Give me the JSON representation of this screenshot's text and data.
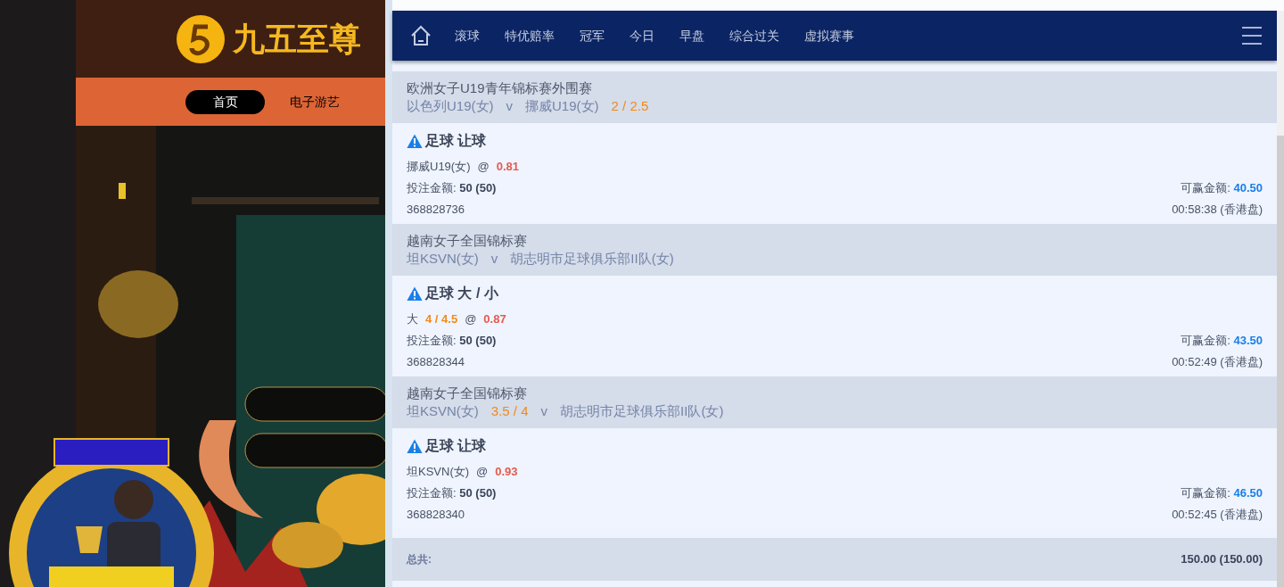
{
  "site": {
    "logo": "九五至尊",
    "nav": [
      {
        "label": "首页",
        "selected": true
      },
      {
        "label": "电子游艺",
        "selected": false
      }
    ]
  },
  "sportsbook": {
    "nav": [
      {
        "label": "滚球"
      },
      {
        "label": "特优赔率"
      },
      {
        "label": "冠军"
      },
      {
        "label": "今日"
      },
      {
        "label": "早盘"
      },
      {
        "label": "综合过关"
      },
      {
        "label": "虚拟赛事"
      }
    ],
    "bets": [
      {
        "league": "欧洲女子U19青年锦标赛外围赛",
        "teams": [
          {
            "kind": "team",
            "text": "以色列U19(女)"
          },
          {
            "kind": "vs",
            "text": "v"
          },
          {
            "kind": "team",
            "text": "挪威U19(女)"
          },
          {
            "kind": "handicap",
            "text": "2 / 2.5"
          }
        ],
        "market": "足球 让球",
        "selection": [
          {
            "kind": "pick",
            "text": "挪威U19(女)"
          },
          {
            "kind": "at",
            "text": "@"
          },
          {
            "kind": "odds",
            "text": "0.81"
          }
        ],
        "stake_label": "投注金额:",
        "stake": "50 (50)",
        "win_label": "可赢金额:",
        "win": "40.50",
        "ticket": "368828736",
        "time": "00:58:38 (香港盘)"
      },
      {
        "league": "越南女子全国锦标赛",
        "teams": [
          {
            "kind": "team",
            "text": "坦KSVN(女)"
          },
          {
            "kind": "vs",
            "text": "v"
          },
          {
            "kind": "team",
            "text": "胡志明市足球俱乐部II队(女)"
          }
        ],
        "market": "足球 大 / 小",
        "selection": [
          {
            "kind": "pick",
            "text": "大"
          },
          {
            "kind": "handicap",
            "text": "4 / 4.5"
          },
          {
            "kind": "at",
            "text": "@"
          },
          {
            "kind": "odds",
            "text": "0.87"
          }
        ],
        "stake_label": "投注金额:",
        "stake": "50 (50)",
        "win_label": "可赢金额:",
        "win": "43.50",
        "ticket": "368828344",
        "time": "00:52:49 (香港盘)"
      },
      {
        "league": "越南女子全国锦标赛",
        "teams": [
          {
            "kind": "team",
            "text": "坦KSVN(女)"
          },
          {
            "kind": "handicap",
            "text": "3.5 / 4"
          },
          {
            "kind": "vs",
            "text": "v"
          },
          {
            "kind": "team",
            "text": "胡志明市足球俱乐部II队(女)"
          }
        ],
        "market": "足球 让球",
        "selection": [
          {
            "kind": "pick",
            "text": "坦KSVN(女)"
          },
          {
            "kind": "at",
            "text": "@"
          },
          {
            "kind": "odds",
            "text": "0.93"
          }
        ],
        "stake_label": "投注金额:",
        "stake": "50 (50)",
        "win_label": "可赢金额:",
        "win": "46.50",
        "ticket": "368828340",
        "time": "00:52:45 (香港盘)"
      }
    ],
    "total": {
      "label": "总共:",
      "value": "150.00 (150.00)"
    }
  }
}
